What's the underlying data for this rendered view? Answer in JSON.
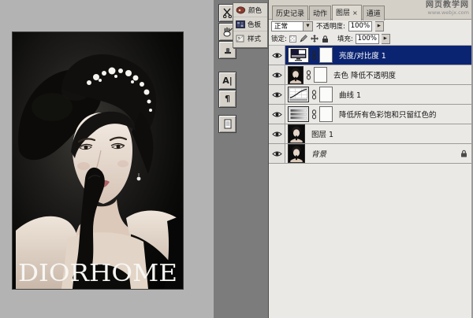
{
  "canvas": {
    "photo_caption": "DIORHOME"
  },
  "watermark": {
    "title": "网页教学网",
    "url": "www.webjx.com"
  },
  "toolbox": {
    "type_glyph": "A|",
    "paragraph_glyph": "¶"
  },
  "mini_panel": {
    "color": "颜色",
    "swatches": "色板",
    "styles": "样式"
  },
  "panel": {
    "tabs": {
      "history": "历史记录",
      "actions": "动作",
      "layers": "图层",
      "layers_close": "×",
      "channels": "通道"
    },
    "blend_mode": "正常",
    "dropdown_arrow": "▼",
    "spin_arrow": "▶",
    "opacity_label": "不透明度:",
    "opacity_value": "100%",
    "lock_label": "锁定:",
    "fill_label": "填充:",
    "fill_value": "100%"
  },
  "layers": [
    {
      "name": "亮度/对比度 1",
      "selected": true,
      "kind": "adjustment-brightness-contrast"
    },
    {
      "name": "去色 降低不透明度",
      "selected": false,
      "kind": "image-with-mask"
    },
    {
      "name": "曲线 1",
      "selected": false,
      "kind": "adjustment-curves"
    },
    {
      "name": "降低所有色彩饱和只留红色的",
      "selected": false,
      "kind": "adjustment-hue-saturation"
    },
    {
      "name": "图层 1",
      "selected": false,
      "kind": "image"
    },
    {
      "name": "背景",
      "selected": false,
      "kind": "background-locked"
    }
  ],
  "colors": {
    "selection_blue": "#0b2472",
    "panel_bg": "#ebe9e5",
    "workspace_gray": "#7c7c7c",
    "canvas_gray": "#b3b3b3"
  }
}
